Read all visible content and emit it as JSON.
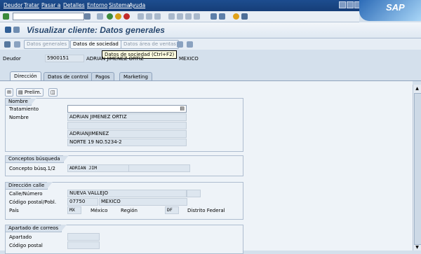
{
  "menu": [
    "Deudor",
    "Tratar",
    "Pasar a",
    "Detalles",
    "Entorno",
    "Sistema",
    "Ayuda"
  ],
  "brand": "SAP",
  "title": "Visualizar cliente: Datos generales",
  "app_toolbar": {
    "datos_generales": "Datos generales",
    "datos_sociedad": "Datos de sociedad",
    "datos_area_ventas": "Datos área de ventas"
  },
  "tooltip": "Datos de sociedad   (Ctrl+F2)",
  "header": {
    "deudor_label": "Deudor",
    "deudor_value": "5900151",
    "name_value": "ADRIAN JIMENEZ ORTIZ",
    "city_value": "MEXICO"
  },
  "tabs": [
    "Dirección",
    "Datos de control",
    "Pagos",
    "Marketing"
  ],
  "prelim_label": "Prelim.",
  "nombre": {
    "title": "Nombre",
    "tratamiento_label": "Tratamiento",
    "nombre_label": "Nombre",
    "nombre1": "ADRIAN JIMENEZ ORTIZ",
    "nombre2": "",
    "nombre3": "ADRIANJIMENEZ",
    "nombre4": "NORTE 19 NO.5234-2"
  },
  "busqueda": {
    "title": "Conceptos búsqueda",
    "label": "Concepto búsq.1/2",
    "value1": "ADRIAN JIM"
  },
  "direccion": {
    "title": "Dirección calle",
    "calle_label": "Calle/Número",
    "calle_value": "NUEVA VALLEJO",
    "cp_label": "Código postal/Pobl.",
    "cp_value": "07750",
    "poblacion_value": "MEXICO",
    "pais_label": "País",
    "pais_code": "MX",
    "pais_name": "México",
    "region_label": "Región",
    "region_code": "DF",
    "region_name": "Distrito Federal"
  },
  "apartado": {
    "title": "Apartado de correos",
    "apartado_label": "Apartado",
    "cp_label": "Código postal"
  },
  "colors": {
    "menubar": "#1d4d8f",
    "title": "#27476e",
    "background": "#d4e0ec"
  }
}
